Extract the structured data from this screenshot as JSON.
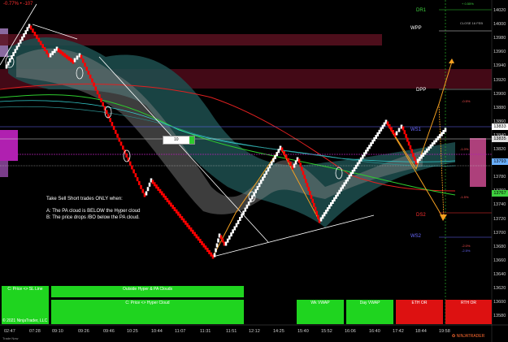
{
  "header": {
    "change": "-0.77% • -107"
  },
  "price_axis": {
    "ticks": [
      "14020",
      "14000",
      "13980",
      "13960",
      "13940",
      "13920",
      "13900",
      "13880",
      "13860",
      "13840",
      "13820",
      "13800",
      "13780",
      "13760",
      "13740",
      "13720",
      "13700",
      "13680",
      "13660",
      "13640",
      "13620",
      "13600",
      "13580"
    ],
    "current_price": "13833",
    "markers": [
      {
        "label": "13835",
        "color": "#ffffff",
        "text": "#000"
      },
      {
        "label": "13793",
        "color": "#6ab0ff",
        "text": "#000"
      },
      {
        "label": "13767",
        "color": "#3fd13f",
        "text": "#000"
      }
    ],
    "top_labels": [
      "+ 0.55%"
    ],
    "close_label": "CLOSE 16 FEB"
  },
  "time_axis": [
    "02:47",
    "07:28",
    "09:10",
    "09:26",
    "09:46",
    "10:25",
    "10:44",
    "11:07",
    "11:31",
    "11:51",
    "12:12",
    "14:25",
    "15:40",
    "15:52",
    "16:06",
    "16:40",
    "17:42",
    "18:44",
    "19:58"
  ],
  "levels": [
    {
      "label": "DR1",
      "color": "#3fd13f"
    },
    {
      "label": "WPP",
      "color": "#ffffff"
    },
    {
      "label": "DPP",
      "color": "#ffffff"
    },
    {
      "label": "WS1",
      "color": "#6a6aff"
    },
    {
      "label": "DS2",
      "color": "#ff3030"
    },
    {
      "label": "WS2",
      "color": "#6a6aff"
    }
  ],
  "pct_labels": [
    "-0.5%",
    "-1.0%",
    "-1.5%",
    "-2.0%",
    "-2.5%"
  ],
  "annotation": {
    "title": "Take Sell Short trades ONLY when:",
    "line_a": "A: The PA cloud is BELOW the Hyper cloud",
    "line_b": "B: The price drops /BO below the PA cloud."
  },
  "order_box": {
    "qty": "10"
  },
  "panels": [
    {
      "label": "C: Price <> SL Line",
      "color": "#1fd41f"
    },
    {
      "label": "Outside Hyper & PA Clouds",
      "color": "#1fd41f"
    },
    {
      "label": "C: Price <> Hyper Cloud",
      "color": "#1fd41f"
    },
    {
      "label": "Wk VWAP",
      "color": "#1fd41f"
    },
    {
      "label": "Day VWAP",
      "color": "#1fd41f"
    },
    {
      "label": "ETH OR",
      "color": "#d11"
    },
    {
      "label": "RTH OR",
      "color": "#d11"
    }
  ],
  "footer": {
    "copyright": "© 2021 NinjaTrader, LLC",
    "symbol": "Trade Now",
    "brand": "NINJATRADER"
  },
  "colors": {
    "bull": "#ffffff",
    "bear": "#ff0000",
    "background": "#000000"
  }
}
